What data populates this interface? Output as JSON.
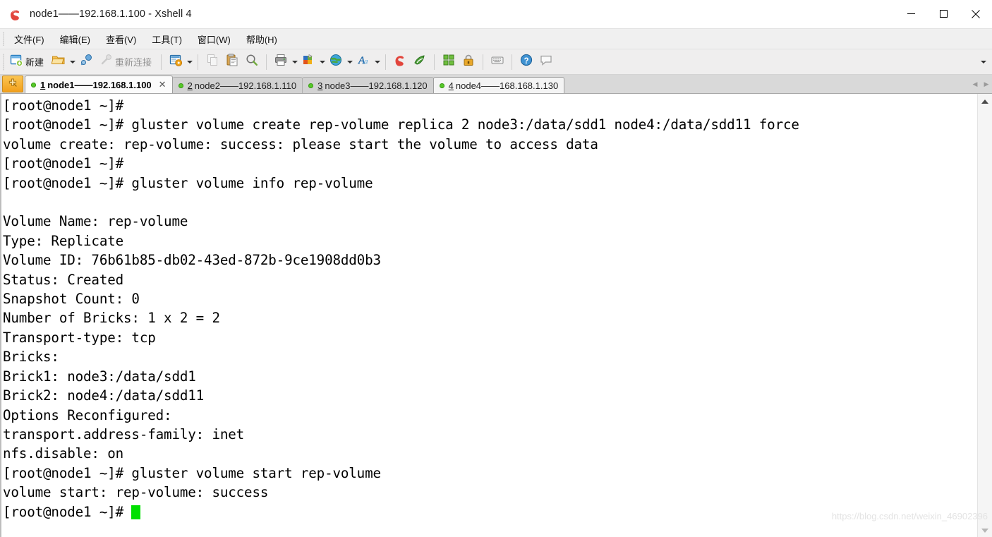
{
  "window": {
    "title": "node1——192.168.1.100 - Xshell 4",
    "app_icon": "xshell-logo-icon",
    "minimize_label": "Minimize",
    "maximize_label": "Maximize",
    "close_label": "Close"
  },
  "menubar": {
    "items": [
      {
        "label": "文件(F)",
        "name": "menu-file"
      },
      {
        "label": "编辑(E)",
        "name": "menu-edit"
      },
      {
        "label": "查看(V)",
        "name": "menu-view"
      },
      {
        "label": "工具(T)",
        "name": "menu-tools"
      },
      {
        "label": "窗口(W)",
        "name": "menu-window"
      },
      {
        "label": "帮助(H)",
        "name": "menu-help"
      }
    ]
  },
  "toolbar": {
    "new_label": "新建",
    "reconnect_label": "重新连接",
    "overflow_label": "更多",
    "buttons": [
      {
        "name": "new-session-button",
        "icon": "new-window-icon"
      },
      {
        "name": "open-folder-button",
        "icon": "open-folder-icon"
      },
      {
        "name": "connect-button",
        "icon": "connect-plug-icon"
      },
      {
        "name": "reconnect-button",
        "icon": "disconnect-plug-icon"
      },
      {
        "name": "session-properties-button",
        "icon": "window-properties-icon"
      },
      {
        "name": "copy-button",
        "icon": "copy-icon"
      },
      {
        "name": "paste-button",
        "icon": "paste-icon"
      },
      {
        "name": "find-button",
        "icon": "magnifier-icon"
      },
      {
        "name": "print-button",
        "icon": "printer-icon"
      },
      {
        "name": "color-scheme-button",
        "icon": "color-palette-icon"
      },
      {
        "name": "web-button",
        "icon": "globe-icon"
      },
      {
        "name": "font-button",
        "icon": "font-a-icon"
      },
      {
        "name": "xshell-button",
        "icon": "xshell-logo-icon"
      },
      {
        "name": "xftp-button",
        "icon": "xftp-icon"
      },
      {
        "name": "arrange-button",
        "icon": "arrange-windows-icon"
      },
      {
        "name": "lock-button",
        "icon": "lock-icon"
      },
      {
        "name": "compose-bar-button",
        "icon": "keyboard-icon"
      },
      {
        "name": "help-button",
        "icon": "question-help-icon"
      },
      {
        "name": "chat-button",
        "icon": "speech-bubble-icon"
      }
    ]
  },
  "tabs": {
    "new_tab_label": "新建标签",
    "items": [
      {
        "num": "1",
        "label": "node1——192.168.1.100",
        "state": "active",
        "closable": true
      },
      {
        "num": "2",
        "label": "node2——192.168.1.110",
        "state": "inactive",
        "closable": false
      },
      {
        "num": "3",
        "label": "node3——192.168.1.120",
        "state": "inactive",
        "closable": false
      },
      {
        "num": "4",
        "label": "node4——168.168.1.130",
        "state": "selected",
        "closable": false
      }
    ]
  },
  "terminal": {
    "cursor_color": "#00e000",
    "lines": [
      "[root@node1 ~]#",
      "[root@node1 ~]# gluster volume create rep-volume replica 2 node3:/data/sdd1 node4:/data/sdd11 force",
      "volume create: rep-volume: success: please start the volume to access data",
      "[root@node1 ~]#",
      "[root@node1 ~]# gluster volume info rep-volume",
      "",
      "Volume Name: rep-volume",
      "Type: Replicate",
      "Volume ID: 76b61b85-db02-43ed-872b-9ce1908dd0b3",
      "Status: Created",
      "Snapshot Count: 0",
      "Number of Bricks: 1 x 2 = 2",
      "Transport-type: tcp",
      "Bricks:",
      "Brick1: node3:/data/sdd1",
      "Brick2: node4:/data/sdd11",
      "Options Reconfigured:",
      "transport.address-family: inet",
      "nfs.disable: on",
      "[root@node1 ~]# gluster volume start rep-volume",
      "volume start: rep-volume: success"
    ],
    "prompt": "[root@node1 ~]# "
  },
  "watermark": {
    "text": "https://blog.csdn.net/weixin_46902396"
  }
}
